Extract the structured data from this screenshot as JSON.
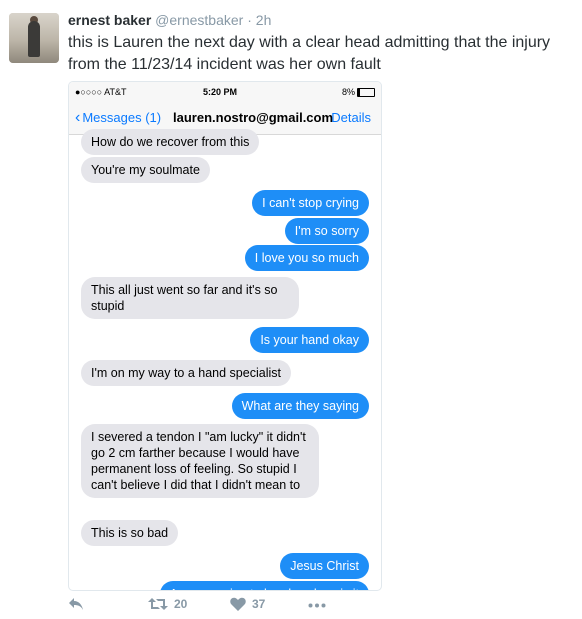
{
  "tweet": {
    "display_name": "ernest baker",
    "handle": "@ernestbaker",
    "separator": "·",
    "time": "2h",
    "text": "this is Lauren the next day with a clear head admitting that the injury from the 11/23/14 incident was her own fault"
  },
  "phone": {
    "status": {
      "carrier": "●○○○○ AT&T",
      "time": "5:20 PM",
      "battery": "8%"
    },
    "nav": {
      "back_label": "Messages (1)",
      "contact": "lauren.nostro@gmail.com",
      "details_label": "Details"
    },
    "messages": [
      {
        "from": "in",
        "text": "How do we recover from this"
      },
      {
        "from": "in",
        "text": "You're my soulmate"
      },
      {
        "from": "out",
        "text": "I can't stop crying"
      },
      {
        "from": "out",
        "text": "I'm so sorry"
      },
      {
        "from": "out",
        "text": "I love you so much"
      },
      {
        "from": "in",
        "text": "This all just went so far and it's so stupid"
      },
      {
        "from": "out",
        "text": "Is your hand okay"
      },
      {
        "from": "in",
        "text": "I'm on my way to a hand specialist"
      },
      {
        "from": "out",
        "text": "What are they saying"
      },
      {
        "from": "in",
        "text": "I severed a tendon I \"am lucky\" it didn't go 2 cm farther because I would have permanent loss of feeling. So stupid I can't believe I did that I didn't mean to"
      },
      {
        "from": "in",
        "text": "This is so bad"
      },
      {
        "from": "out",
        "text": "Jesus Christ"
      },
      {
        "from": "out",
        "text": "Are you going to be okay, how is it"
      }
    ]
  },
  "actions": {
    "retweet_count": "20",
    "like_count": "37"
  },
  "icons": [
    "reply-icon",
    "retweet-icon",
    "heart-icon",
    "more-icon"
  ],
  "colors": {
    "imessage_blue": "#1e8ef7",
    "received_gray": "#e5e5ea",
    "ios_link_blue": "#0a7aff",
    "twitter_gray": "#8899a6"
  }
}
